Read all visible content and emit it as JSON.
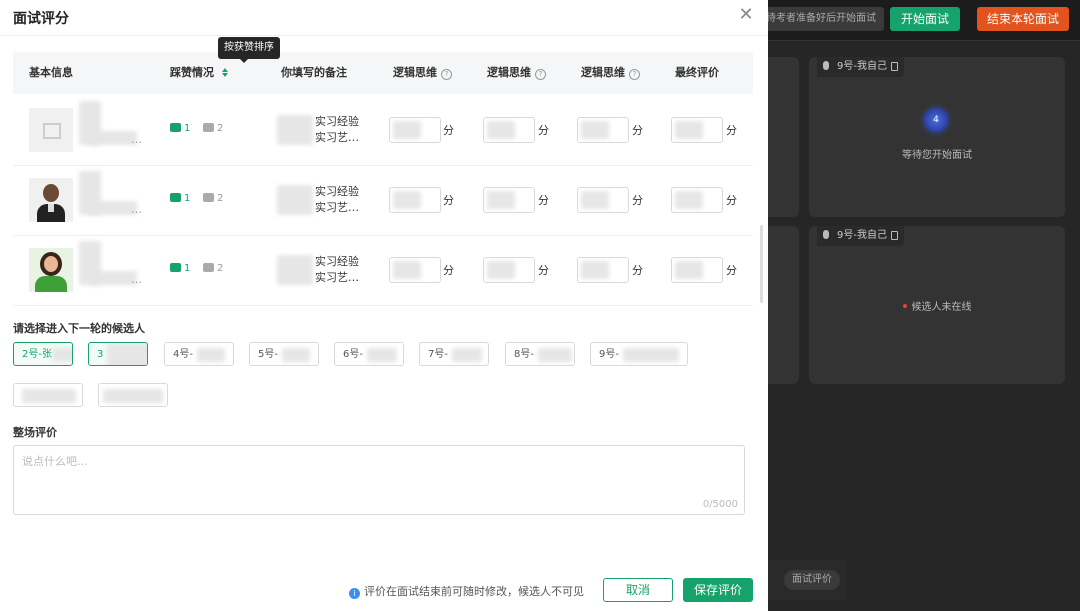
{
  "background": {
    "prep_text": "待考者准备好后开始面试",
    "start_button": "开始面试",
    "end_button": "结束本轮面试",
    "tiles": [
      {
        "label": "9号-我自己",
        "avatar_text": "4",
        "status": "等待您开始面试"
      },
      {
        "label": "9号-我自己",
        "status": "候选人未在线"
      }
    ],
    "bottom_pill": "面试评价",
    "colors": {
      "start": "#16a36b",
      "end": "#e2531d",
      "offline_dot": "#e0472f"
    }
  },
  "modal": {
    "title": "面试评分",
    "tooltip": "按获赞排序",
    "headers": {
      "basic": "基本信息",
      "votes": "踩赞情况",
      "note": "你填写的备注",
      "logic1": "逻辑思维",
      "logic2": "逻辑思维",
      "logic3": "逻辑思维",
      "final": "最终评价"
    },
    "rows": [
      {
        "likes": "1",
        "dislikes": "2",
        "note_line1": "实习经验",
        "note_line2": "实习艺…",
        "name_ellipsis": "…",
        "unit": "分"
      },
      {
        "likes": "1",
        "dislikes": "2",
        "note_line1": "实习经验",
        "note_line2": "实习艺…",
        "name_ellipsis": "…",
        "unit": "分"
      },
      {
        "likes": "1",
        "dislikes": "2",
        "note_line1": "实习经验",
        "note_line2": "实习艺…",
        "name_ellipsis": "…",
        "unit": "分"
      }
    ],
    "next_round_label": "请选择进入下一轮的候选人",
    "candidates": [
      "2号-张",
      "3",
      "4号-",
      "5号-",
      "6号-",
      "7号-",
      "8号-",
      "9号-",
      "",
      ""
    ],
    "overall_label": "整场评价",
    "overall_placeholder": "说点什么吧…",
    "overall_counter": "0/5000",
    "footer_note": "评价在面试结束前可随时修改，候选人不可见",
    "cancel": "取消",
    "save": "保存评价",
    "accent": "#16a36b"
  }
}
